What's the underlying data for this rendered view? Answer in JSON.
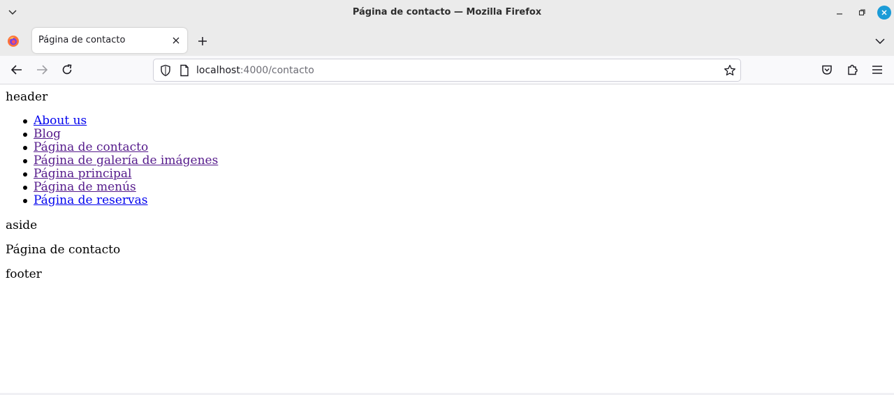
{
  "window": {
    "title": "Página de contacto — Mozilla Firefox"
  },
  "tabs": [
    {
      "label": "Página de contacto",
      "active": true
    }
  ],
  "navigation": {
    "url_host": "localhost",
    "url_rest": ":4000/contacto"
  },
  "page": {
    "header_text": "header",
    "links": [
      {
        "label": "About us",
        "visited": false
      },
      {
        "label": "Blog",
        "visited": true
      },
      {
        "label": "Página de contacto",
        "visited": true
      },
      {
        "label": "Página de galería de imágenes",
        "visited": true
      },
      {
        "label": "Página principal",
        "visited": true
      },
      {
        "label": "Página de menús",
        "visited": true
      },
      {
        "label": "Página de reservas",
        "visited": false
      }
    ],
    "aside_text": "aside",
    "main_text": "Página de contacto",
    "footer_text": "footer"
  },
  "colors": {
    "link_unvisited": "#0000ee",
    "link_visited": "#551a8b",
    "close_button": "#1a9bd7"
  },
  "icons": {
    "window_menu": "chevron-down-icon",
    "minimize": "minimize-icon",
    "maximize": "restore-icon",
    "close": "close-icon",
    "browser_logo": "firefox-logo-icon",
    "tab_close": "close-icon",
    "new_tab": "plus-icon",
    "tab_list": "chevron-down-icon",
    "back": "arrow-left-icon",
    "forward": "arrow-right-icon",
    "reload": "reload-icon",
    "tracking": "shield-icon",
    "page_info": "page-icon",
    "bookmark": "star-icon",
    "pocket": "pocket-icon",
    "extensions": "puzzle-icon",
    "app_menu": "hamburger-icon"
  }
}
